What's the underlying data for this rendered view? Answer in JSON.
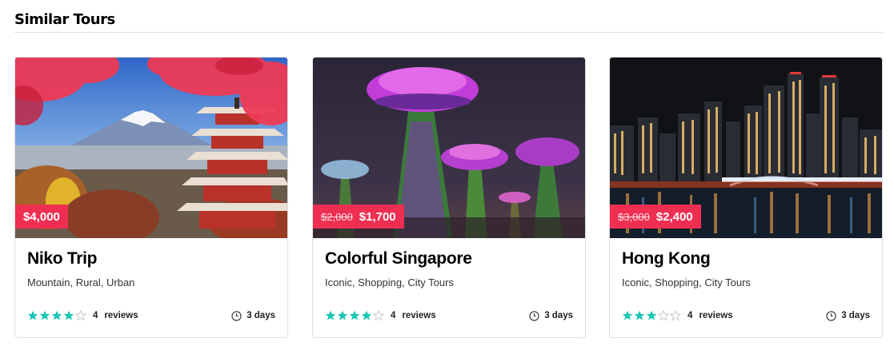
{
  "section": {
    "title": "Similar Tours"
  },
  "tours": [
    {
      "title": "Niko Trip",
      "tags": "Mountain, Rural, Urban",
      "price_old": "",
      "price_new": "$4,000",
      "rating": 4,
      "reviews_count": "4",
      "reviews_label": "reviews",
      "duration": "3 days",
      "image": "mount-fuji-pagoda-photo"
    },
    {
      "title": "Colorful Singapore",
      "tags": "Iconic, Shopping, City Tours",
      "price_old": "$2,000",
      "price_new": "$1,700",
      "rating": 4,
      "reviews_count": "4",
      "reviews_label": "reviews",
      "duration": "3 days",
      "image": "supertree-grove-night-photo"
    },
    {
      "title": "Hong Kong",
      "tags": "Iconic, Shopping, City Tours",
      "price_old": "$3,000",
      "price_new": "$2,400",
      "rating": 3,
      "reviews_count": "4",
      "reviews_label": "reviews",
      "duration": "3 days",
      "image": "city-skyline-night-photo"
    }
  ],
  "colors": {
    "badge": "#ef2f52",
    "star_filled": "#1ec6b6",
    "star_empty": "#c8c8c8"
  }
}
